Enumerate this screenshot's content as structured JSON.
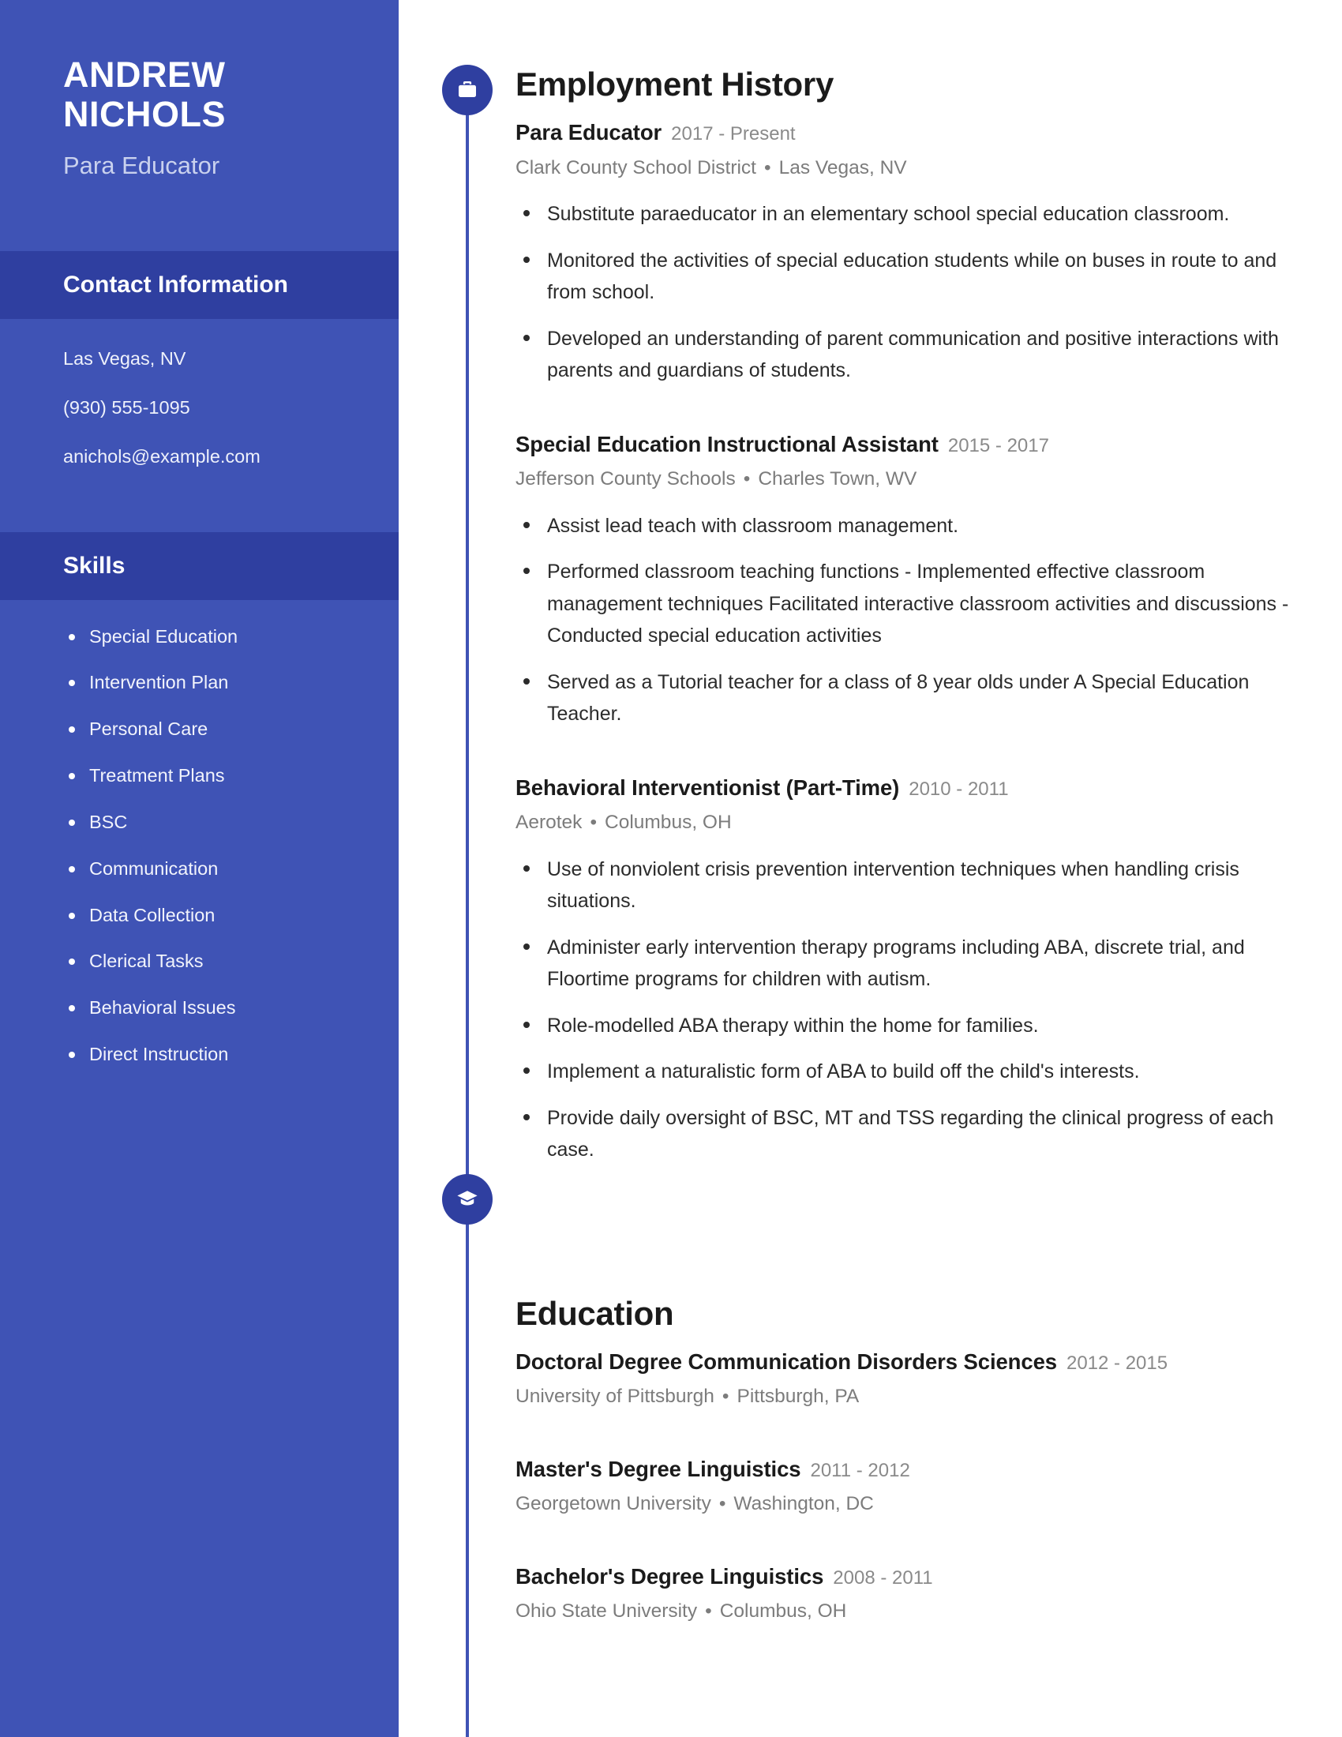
{
  "sidebar": {
    "name_first": "ANDREW",
    "name_last": "NICHOLS",
    "job_title": "Para Educator",
    "contact": {
      "heading": "Contact Information",
      "location": "Las Vegas, NV",
      "phone": "(930) 555-1095",
      "email": "anichols@example.com"
    },
    "skills": {
      "heading": "Skills",
      "items": [
        "Special Education",
        "Intervention Plan",
        "Personal Care",
        "Treatment Plans",
        "BSC",
        "Communication",
        "Data Collection",
        "Clerical Tasks",
        "Behavioral Issues",
        "Direct Instruction"
      ]
    },
    "colors": {
      "sidebar_bg": "#3f53b5",
      "section_band_bg": "#2f3fa0",
      "accent": "#2f3fa0",
      "subtitle_text": "#c9d1ee"
    }
  },
  "employment": {
    "heading": "Employment History",
    "icon": "briefcase-icon",
    "entries": [
      {
        "title": "Para Educator",
        "dates": "2017 - Present",
        "employer": "Clark County School District",
        "location": "Las Vegas, NV",
        "bullets": [
          "Substitute paraeducator in an elementary school special education classroom.",
          "Monitored the activities of special education students while on buses in route to and from school.",
          "Developed an understanding of parent communication and positive interactions with parents and guardians of students."
        ]
      },
      {
        "title": "Special Education Instructional Assistant",
        "dates": "2015 - 2017",
        "employer": "Jefferson County Schools",
        "location": "Charles Town, WV",
        "bullets": [
          "Assist lead teach with classroom management.",
          "Performed classroom teaching functions - Implemented effective classroom management techniques Facilitated interactive classroom activities and discussions - Conducted special education activities",
          "Served as a Tutorial teacher for a class of 8 year olds under A Special Education Teacher."
        ]
      },
      {
        "title": "Behavioral Interventionist (Part-Time)",
        "dates": "2010 - 2011",
        "employer": "Aerotek",
        "location": "Columbus, OH",
        "bullets": [
          "Use of nonviolent crisis prevention intervention techniques when handling crisis situations.",
          "Administer early intervention therapy programs including ABA, discrete trial, and Floortime programs for children with autism.",
          "Role-modelled ABA therapy within the home for families.",
          "Implement a naturalistic form of ABA to build off the child's interests.",
          "Provide daily oversight of BSC, MT and TSS regarding the clinical progress of each case."
        ]
      }
    ]
  },
  "education": {
    "heading": "Education",
    "icon": "graduation-cap-icon",
    "entries": [
      {
        "title": "Doctoral Degree Communication Disorders Sciences",
        "dates": "2012 - 2015",
        "school": "University of Pittsburgh",
        "location": "Pittsburgh, PA"
      },
      {
        "title": "Master's Degree Linguistics",
        "dates": "2011 - 2012",
        "school": "Georgetown University",
        "location": "Washington, DC"
      },
      {
        "title": "Bachelor's Degree Linguistics",
        "dates": "2008 - 2011",
        "school": "Ohio State University",
        "location": "Columbus, OH"
      }
    ]
  },
  "separator": "•"
}
